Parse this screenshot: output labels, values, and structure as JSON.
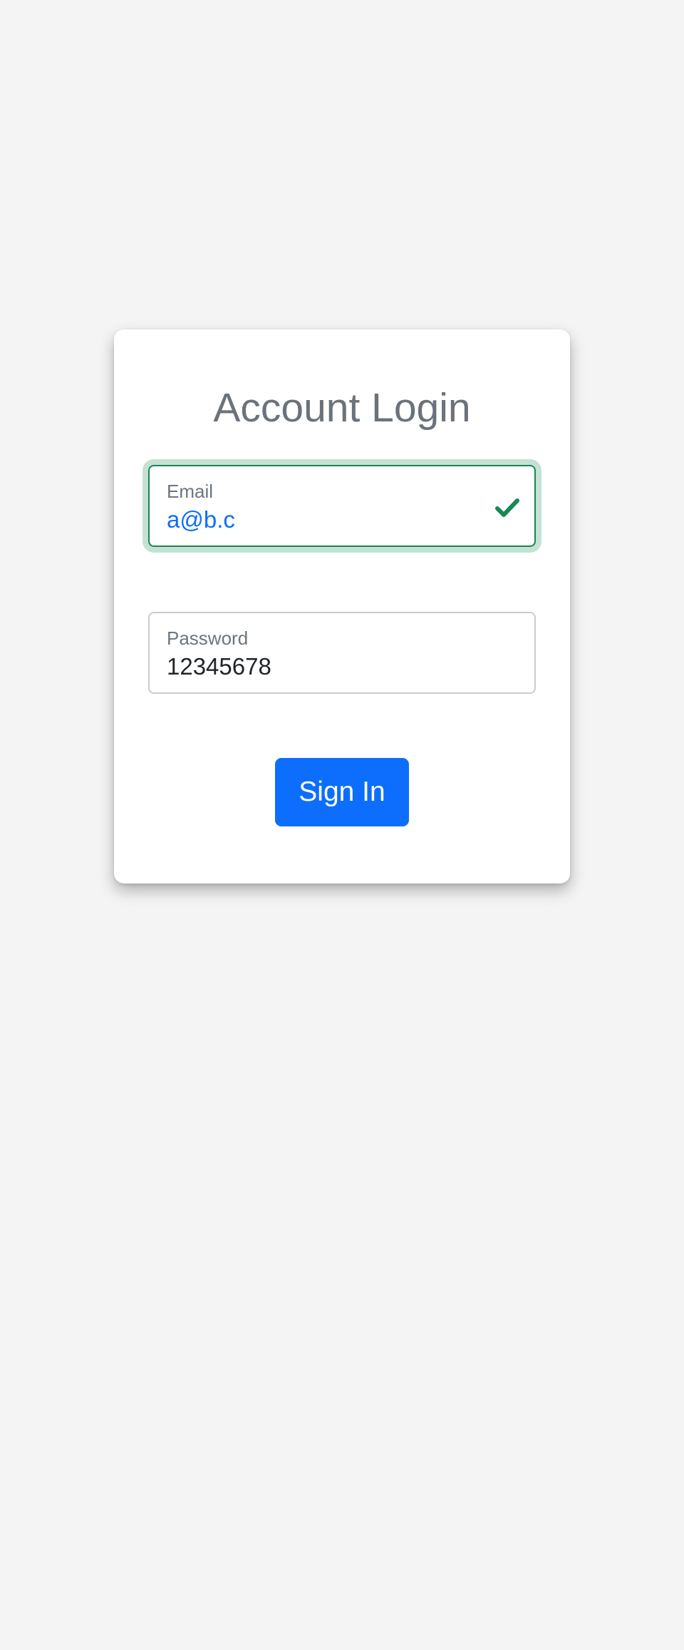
{
  "login": {
    "title": "Account Login",
    "email": {
      "label": "Email",
      "value": "a@b.c",
      "valid": true,
      "icon": "check-icon",
      "valid_color": "#198754"
    },
    "password": {
      "label": "Password",
      "value": "12345678"
    },
    "submit_label": "Sign In"
  },
  "colors": {
    "background": "#f4f4f4",
    "primary": "#0d6efd",
    "success": "#198754",
    "title_text": "#6b727a"
  }
}
